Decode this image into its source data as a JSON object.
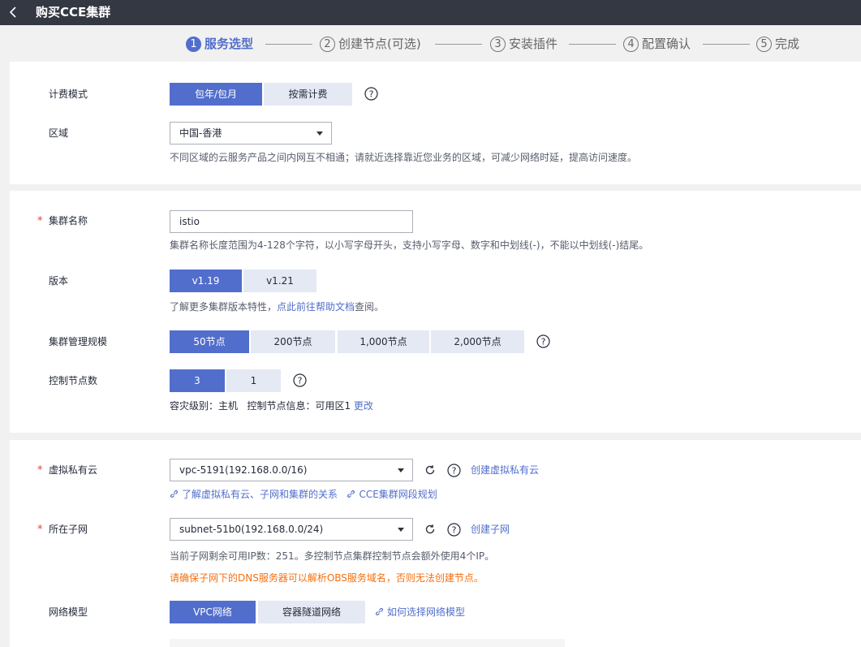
{
  "header": {
    "title": "购买CCE集群"
  },
  "steps": [
    {
      "num": "1",
      "label": "服务选型",
      "active": true
    },
    {
      "num": "2",
      "label": "创建节点(可选)"
    },
    {
      "num": "3",
      "label": "安装插件"
    },
    {
      "num": "4",
      "label": "配置确认"
    },
    {
      "num": "5",
      "label": "完成"
    }
  ],
  "billing": {
    "label": "计费模式",
    "options": [
      "包年/包月",
      "按需计费"
    ],
    "selected": "包年/包月"
  },
  "region": {
    "label": "区域",
    "value": "中国-香港",
    "hint": "不同区域的云服务产品之间内网互不相通；请就近选择靠近您业务的区域，可减少网络时延，提高访问速度。"
  },
  "cluster_name": {
    "label": "集群名称",
    "required_mark": "*",
    "value": "istio",
    "hint": "集群名称长度范围为4-128个字符，以小写字母开头，支持小写字母、数字和中划线(-)，不能以中划线(-)结尾。"
  },
  "version": {
    "label": "版本",
    "options": [
      "v1.19",
      "v1.21"
    ],
    "selected": "v1.19",
    "hint_prefix": "了解更多集群版本特性，",
    "hint_link": "点此前往帮助文档",
    "hint_suffix": "查阅。"
  },
  "scale": {
    "label": "集群管理规模",
    "options": [
      "50节点",
      "200节点",
      "1,000节点",
      "2,000节点"
    ],
    "selected": "50节点"
  },
  "masters": {
    "label": "控制节点数",
    "options": [
      "3",
      "1"
    ],
    "selected": "3",
    "info_text": "容灾级别：主机   控制节点信息：可用区1",
    "info_link": "更改"
  },
  "vpc": {
    "label": "虚拟私有云",
    "required_mark": "*",
    "value": "vpc-5191(192.168.0.0/16)",
    "create_link": "创建虚拟私有云",
    "help_link_1": "了解虚拟私有云、子网和集群的关系",
    "help_link_2": "CCE集群网段规划"
  },
  "subnet": {
    "label": "所在子网",
    "required_mark": "*",
    "value": "subnet-51b0(192.168.0.0/24)",
    "create_link": "创建子网",
    "hint": "当前子网剩余可用IP数：251。多控制节点集群控制节点会额外使用4个IP。",
    "warning": "请确保子网下的DNS服务器可以解析OBS服务域名，否则无法创建节点。"
  },
  "network_model": {
    "label": "网络模型",
    "options": [
      "VPC网络",
      "容器隧道网络"
    ],
    "selected": "VPC网络",
    "help_link": "如何选择网络模型"
  },
  "colors": {
    "primary": "#526ecc",
    "warning": "#f66f0f",
    "required": "#e43d3d",
    "topbar": "#343843"
  }
}
